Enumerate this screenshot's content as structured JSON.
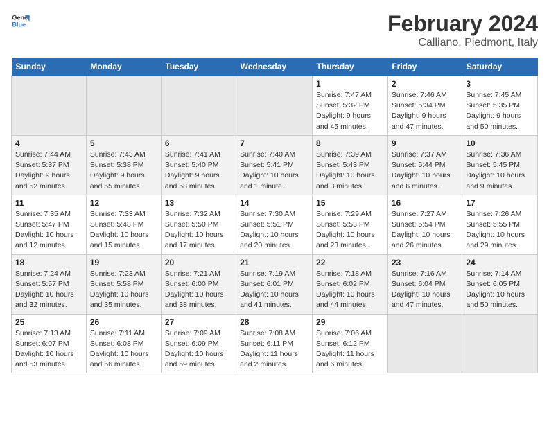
{
  "header": {
    "logo_line1": "General",
    "logo_line2": "Blue",
    "main_title": "February 2024",
    "sub_title": "Calliano, Piedmont, Italy"
  },
  "weekdays": [
    "Sunday",
    "Monday",
    "Tuesday",
    "Wednesday",
    "Thursday",
    "Friday",
    "Saturday"
  ],
  "weeks": [
    [
      {
        "day": "",
        "info": ""
      },
      {
        "day": "",
        "info": ""
      },
      {
        "day": "",
        "info": ""
      },
      {
        "day": "",
        "info": ""
      },
      {
        "day": "1",
        "info": "Sunrise: 7:47 AM\nSunset: 5:32 PM\nDaylight: 9 hours\nand 45 minutes."
      },
      {
        "day": "2",
        "info": "Sunrise: 7:46 AM\nSunset: 5:34 PM\nDaylight: 9 hours\nand 47 minutes."
      },
      {
        "day": "3",
        "info": "Sunrise: 7:45 AM\nSunset: 5:35 PM\nDaylight: 9 hours\nand 50 minutes."
      }
    ],
    [
      {
        "day": "4",
        "info": "Sunrise: 7:44 AM\nSunset: 5:37 PM\nDaylight: 9 hours\nand 52 minutes."
      },
      {
        "day": "5",
        "info": "Sunrise: 7:43 AM\nSunset: 5:38 PM\nDaylight: 9 hours\nand 55 minutes."
      },
      {
        "day": "6",
        "info": "Sunrise: 7:41 AM\nSunset: 5:40 PM\nDaylight: 9 hours\nand 58 minutes."
      },
      {
        "day": "7",
        "info": "Sunrise: 7:40 AM\nSunset: 5:41 PM\nDaylight: 10 hours\nand 1 minute."
      },
      {
        "day": "8",
        "info": "Sunrise: 7:39 AM\nSunset: 5:43 PM\nDaylight: 10 hours\nand 3 minutes."
      },
      {
        "day": "9",
        "info": "Sunrise: 7:37 AM\nSunset: 5:44 PM\nDaylight: 10 hours\nand 6 minutes."
      },
      {
        "day": "10",
        "info": "Sunrise: 7:36 AM\nSunset: 5:45 PM\nDaylight: 10 hours\nand 9 minutes."
      }
    ],
    [
      {
        "day": "11",
        "info": "Sunrise: 7:35 AM\nSunset: 5:47 PM\nDaylight: 10 hours\nand 12 minutes."
      },
      {
        "day": "12",
        "info": "Sunrise: 7:33 AM\nSunset: 5:48 PM\nDaylight: 10 hours\nand 15 minutes."
      },
      {
        "day": "13",
        "info": "Sunrise: 7:32 AM\nSunset: 5:50 PM\nDaylight: 10 hours\nand 17 minutes."
      },
      {
        "day": "14",
        "info": "Sunrise: 7:30 AM\nSunset: 5:51 PM\nDaylight: 10 hours\nand 20 minutes."
      },
      {
        "day": "15",
        "info": "Sunrise: 7:29 AM\nSunset: 5:53 PM\nDaylight: 10 hours\nand 23 minutes."
      },
      {
        "day": "16",
        "info": "Sunrise: 7:27 AM\nSunset: 5:54 PM\nDaylight: 10 hours\nand 26 minutes."
      },
      {
        "day": "17",
        "info": "Sunrise: 7:26 AM\nSunset: 5:55 PM\nDaylight: 10 hours\nand 29 minutes."
      }
    ],
    [
      {
        "day": "18",
        "info": "Sunrise: 7:24 AM\nSunset: 5:57 PM\nDaylight: 10 hours\nand 32 minutes."
      },
      {
        "day": "19",
        "info": "Sunrise: 7:23 AM\nSunset: 5:58 PM\nDaylight: 10 hours\nand 35 minutes."
      },
      {
        "day": "20",
        "info": "Sunrise: 7:21 AM\nSunset: 6:00 PM\nDaylight: 10 hours\nand 38 minutes."
      },
      {
        "day": "21",
        "info": "Sunrise: 7:19 AM\nSunset: 6:01 PM\nDaylight: 10 hours\nand 41 minutes."
      },
      {
        "day": "22",
        "info": "Sunrise: 7:18 AM\nSunset: 6:02 PM\nDaylight: 10 hours\nand 44 minutes."
      },
      {
        "day": "23",
        "info": "Sunrise: 7:16 AM\nSunset: 6:04 PM\nDaylight: 10 hours\nand 47 minutes."
      },
      {
        "day": "24",
        "info": "Sunrise: 7:14 AM\nSunset: 6:05 PM\nDaylight: 10 hours\nand 50 minutes."
      }
    ],
    [
      {
        "day": "25",
        "info": "Sunrise: 7:13 AM\nSunset: 6:07 PM\nDaylight: 10 hours\nand 53 minutes."
      },
      {
        "day": "26",
        "info": "Sunrise: 7:11 AM\nSunset: 6:08 PM\nDaylight: 10 hours\nand 56 minutes."
      },
      {
        "day": "27",
        "info": "Sunrise: 7:09 AM\nSunset: 6:09 PM\nDaylight: 10 hours\nand 59 minutes."
      },
      {
        "day": "28",
        "info": "Sunrise: 7:08 AM\nSunset: 6:11 PM\nDaylight: 11 hours\nand 2 minutes."
      },
      {
        "day": "29",
        "info": "Sunrise: 7:06 AM\nSunset: 6:12 PM\nDaylight: 11 hours\nand 6 minutes."
      },
      {
        "day": "",
        "info": ""
      },
      {
        "day": "",
        "info": ""
      }
    ]
  ]
}
